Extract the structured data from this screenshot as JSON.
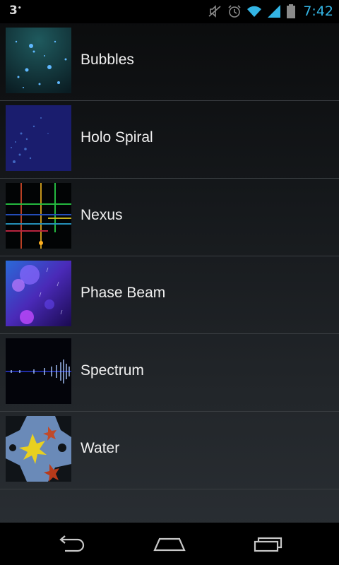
{
  "status_bar": {
    "notification_count": "3",
    "time": "7:42",
    "icons": [
      "muted-icon",
      "alarm-icon",
      "wifi-icon",
      "signal-icon",
      "battery-icon"
    ],
    "accent_color": "#33b5e5"
  },
  "wallpapers": [
    {
      "name": "Bubbles",
      "thumb_icon": "bubbles-thumbnail"
    },
    {
      "name": "Holo Spiral",
      "thumb_icon": "holo-spiral-thumbnail"
    },
    {
      "name": "Nexus",
      "thumb_icon": "nexus-thumbnail"
    },
    {
      "name": "Phase Beam",
      "thumb_icon": "phase-beam-thumbnail"
    },
    {
      "name": "Spectrum",
      "thumb_icon": "spectrum-thumbnail"
    },
    {
      "name": "Water",
      "thumb_icon": "water-thumbnail"
    }
  ],
  "nav_bar": {
    "buttons": [
      "back-icon",
      "home-icon",
      "recent-apps-icon"
    ]
  }
}
